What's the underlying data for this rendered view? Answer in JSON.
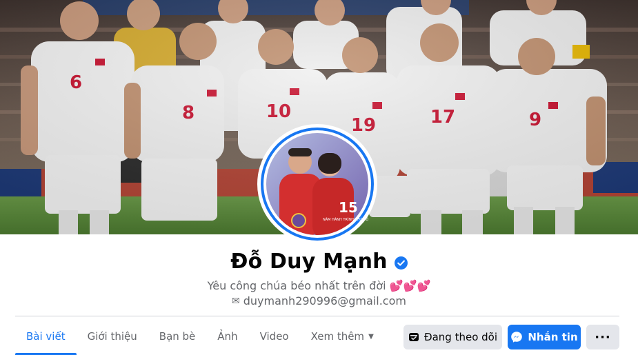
{
  "profile": {
    "name": "Đỗ Duy Mạnh",
    "verified_icon": "verified-badge-icon",
    "bio": "Yêu công chúa béo nhất trên đời 💕💕💕",
    "email": "duymanh290996@gmail.com",
    "email_icon": "✉"
  },
  "cover": {
    "jersey_numbers": [
      "6",
      "8",
      "10",
      "19",
      "17",
      "9"
    ]
  },
  "avatar": {
    "badge_text": "15",
    "badge_caption": "NĂM HÀNH TRÌNH THỦ ĐÔ"
  },
  "tabs": [
    {
      "label": "Bài viết",
      "active": true
    },
    {
      "label": "Giới thiệu"
    },
    {
      "label": "Bạn bè"
    },
    {
      "label": "Ảnh"
    },
    {
      "label": "Video"
    },
    {
      "label": "Xem thêm",
      "caret": "▼"
    }
  ],
  "actions": {
    "follow_label": "Đang theo dõi",
    "message_label": "Nhắn tin",
    "more_label": "···"
  },
  "colors": {
    "accent": "#1877f2",
    "button_gray": "#e4e6eb",
    "secondary_text": "#65676b",
    "cover_grass": "#5a8a3a",
    "jersey_white": "#f2f2f2",
    "jersey_red": "#c8102e"
  }
}
